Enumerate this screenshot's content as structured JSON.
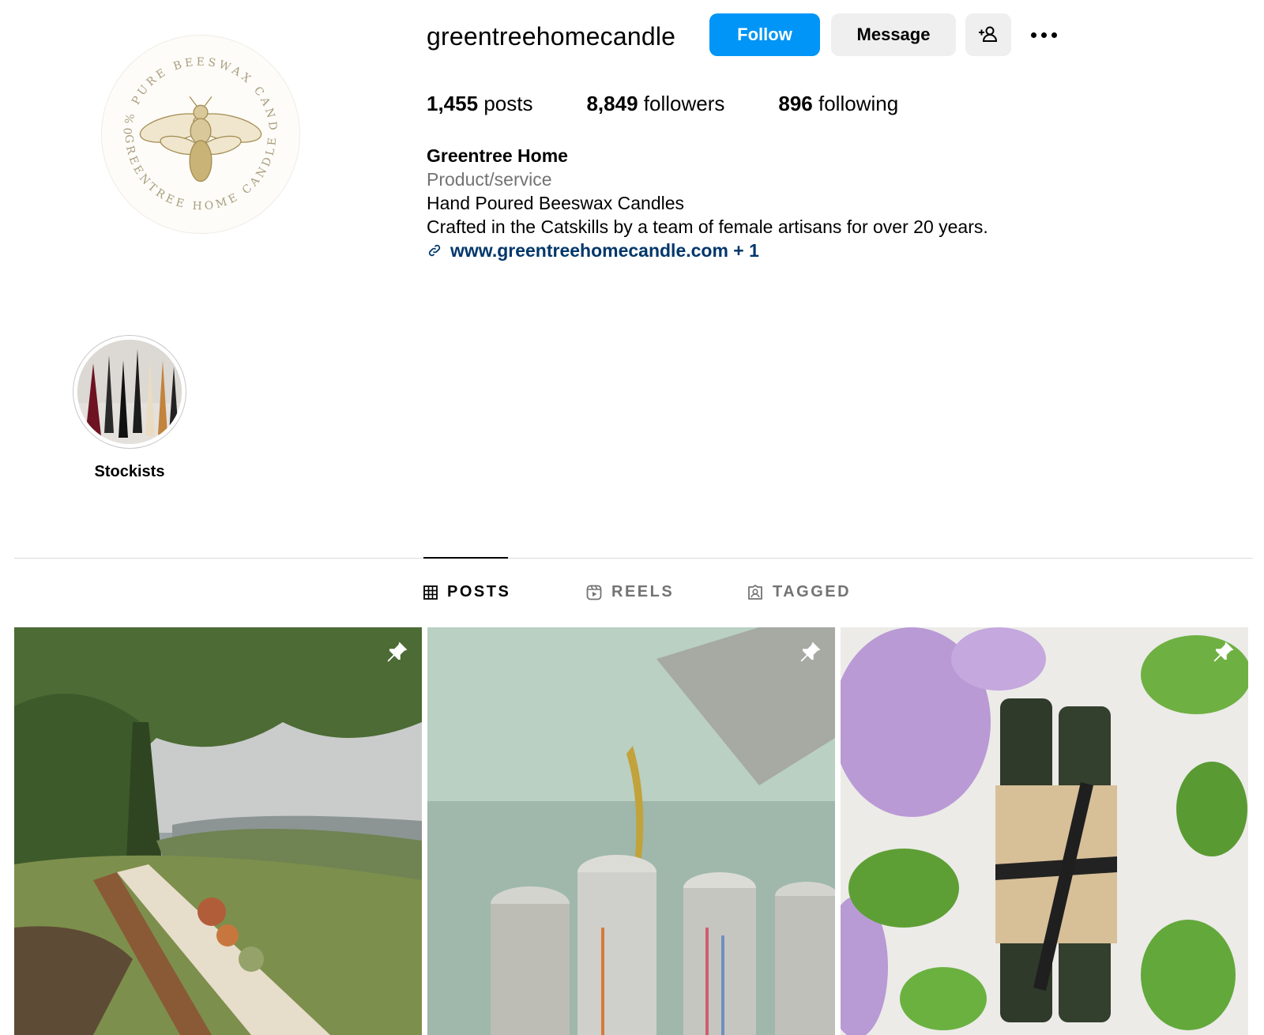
{
  "profile": {
    "username": "greentreehomecandle",
    "avatar_logo_text_top": "100% PURE BEESWAX CANDLE",
    "avatar_logo_text_bottom": "GREENTREE HOME CANDLE",
    "avatar_icon": "bee-logo"
  },
  "actions": {
    "follow_label": "Follow",
    "message_label": "Message",
    "add_user_icon": "add-person-icon",
    "more_icon": "more-options-icon",
    "follow_color": "#0095f6"
  },
  "stats": {
    "posts_count": "1,455",
    "posts_label": "posts",
    "followers_count": "8,849",
    "followers_label": "followers",
    "following_count": "896",
    "following_label": "following"
  },
  "bio": {
    "name": "Greentree Home",
    "category": "Product/service",
    "line1": "Hand Poured Beeswax Candles",
    "line2": "Crafted in the Catskills by a team of female artisans for over 20 years.",
    "link": "www.greentreehomecandle.com + 1",
    "link_icon": "link-icon",
    "link_color": "#00376b"
  },
  "highlights": [
    {
      "label": "Stockists"
    }
  ],
  "tabs": [
    {
      "label": "POSTS",
      "icon": "grid-icon",
      "active": true
    },
    {
      "label": "REELS",
      "icon": "reels-icon",
      "active": false
    },
    {
      "label": "TAGGED",
      "icon": "tagged-icon",
      "active": false
    }
  ],
  "posts": [
    {
      "subject": "outdoor-dinner-table",
      "pinned": true
    },
    {
      "subject": "wax-pouring",
      "pinned": true
    },
    {
      "subject": "green-taper-candles-with-lilacs",
      "pinned": true
    }
  ]
}
